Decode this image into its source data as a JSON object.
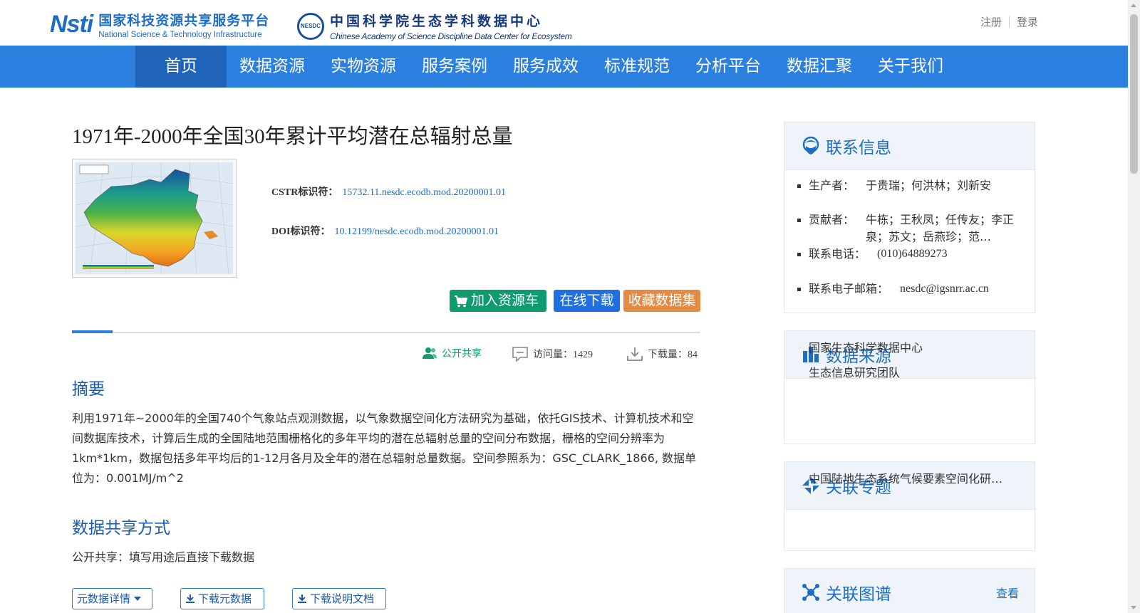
{
  "header": {
    "logo_cstr_mark": "Nsti",
    "logo_cstr_cn": "国家科技资源共享服务平台",
    "logo_cstr_en": "National Science & Technology Infrastructure",
    "logo_nesdc_seal": "NESDC",
    "logo_nesdc_cn": "中国科学院生态学科数据中心",
    "logo_nesdc_en": "Chinese Academy of Science Discipline Data Center for Ecosystem",
    "register": "注册",
    "login": "登录"
  },
  "nav": {
    "items": [
      "首页",
      "数据资源",
      "实物资源",
      "服务案例",
      "服务成效",
      "标准规范",
      "分析平台",
      "数据汇聚",
      "关于我们"
    ],
    "active_index": 0
  },
  "dataset": {
    "title": "1971年-2000年全国30年累计平均潜在总辐射总量",
    "thumbnail_title": "1月潜在总辐射",
    "cstr_label": "CSTR标识符：",
    "cstr_value": "15732.11.nesdc.ecodb.mod.20200001.01",
    "doi_label": "DOI标识符：",
    "doi_value": "10.12199/nesdc.ecodb.mod.20200001.01"
  },
  "actions": {
    "add_cart": "加入资源车",
    "download_online": "在线下载",
    "favorite": "收藏数据集"
  },
  "stats": {
    "share_mode": "公开共享",
    "visits": "访问量：1429",
    "downloads": "下载量：84"
  },
  "abstract": {
    "heading": "摘要",
    "text": "利用1971年~2000年的全国740个气象站点观测数据，以气象数据空间化方法研究为基础，依托GIS技术、计算机技术和空间数据库技术，计算后生成的全国陆地范围栅格化的多年平均的潜在总辐射总量的空间分布数据，栅格的空间分辨率为1km*1km，数据包括多年平均后的1-12月各月及全年的潜在总辐射总量数据。空间参照系为：GSC_CLARK_1866, 数据单位为：0.001MJ/m^2"
  },
  "share": {
    "heading": "数据共享方式",
    "text": "公开共享：填写用途后直接下载数据"
  },
  "bottom_buttons": {
    "meta_detail": "元数据详情",
    "download_meta": "下载元数据",
    "download_doc": "下载说明文档"
  },
  "contact": {
    "title": "联系信息",
    "producer_label": "生产者：",
    "producer": "于贵瑞；何洪林；刘新安",
    "contributor_label": "贡献者：",
    "contributor": "牛栋；王秋凤；任传友；李正泉；苏文；岳燕珍；范…",
    "phone_label": "联系电话：",
    "phone": "(010)64889273",
    "email_label": "联系电子邮箱：",
    "email": "nesdc@igsnrr.ac.cn"
  },
  "source": {
    "title": "数据来源",
    "items": [
      "国家生态科学数据中心",
      "生态信息研究团队"
    ]
  },
  "topic": {
    "title": "关联专题",
    "items": [
      "中国陆地生态系统气候要素空间化研…"
    ]
  },
  "graph": {
    "title": "关联图谱",
    "more": "查看"
  },
  "colors": {
    "nav_bg": "#2b7fde",
    "nav_active": "#1f64b8",
    "cart_green": "#0e9b6e",
    "download_blue": "#1f6fe0",
    "favorite_orange": "#e58b44",
    "link_blue": "#1d6dc4"
  }
}
